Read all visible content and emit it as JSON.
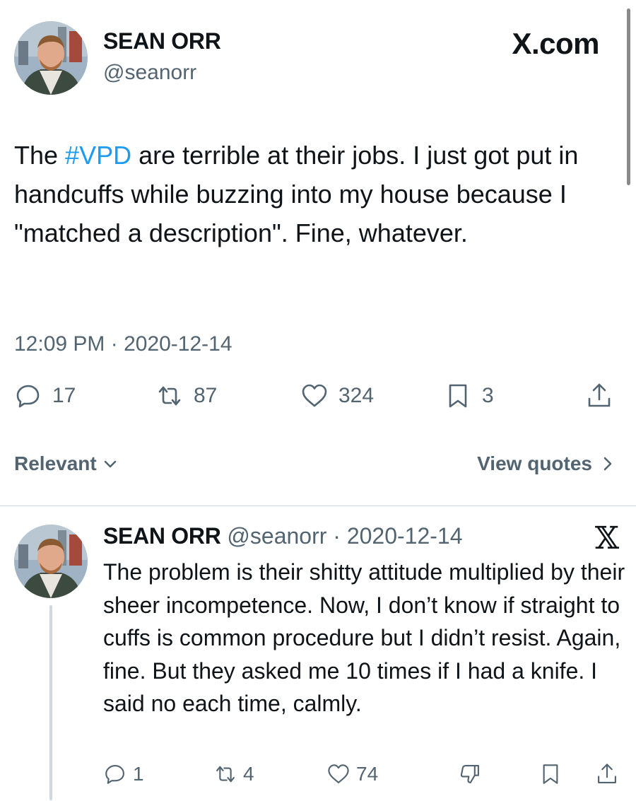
{
  "tweet": {
    "author_name": "SEAN ORR",
    "author_handle": "@seanorr",
    "brand": "X.com",
    "text_before_hashtag": "The ",
    "hashtag": "#VPD",
    "text_after_hashtag": " are terrible at their jobs. I just got put in handcuffs while buzzing into my house because I \"matched a description\". Fine, whatever.",
    "timestamp": "12:09 PM · 2020-12-14",
    "stats": {
      "replies": "17",
      "reposts": "87",
      "likes": "324",
      "bookmarks": "3"
    }
  },
  "sort": {
    "label": "Relevant",
    "view_quotes": "View quotes"
  },
  "reply": {
    "author_name": "SEAN ORR",
    "meta": " @seanorr · 2020-12-14",
    "text": "The problem is their shitty attitude multiplied by their sheer incompetence. Now, I don’t know if straight to cuffs is common procedure but I didn’t resist. Again, fine. But they asked me 10 times if I had a knife. I said no each time, calmly.",
    "stats": {
      "replies": "1",
      "reposts": "4",
      "likes": "74"
    }
  },
  "icons": {
    "reply": "reply-icon",
    "repost": "repost-icon",
    "like": "heart-icon",
    "bookmark": "bookmark-icon",
    "share": "share-icon",
    "dislike": "thumbs-down-icon",
    "x_logo": "x-logo-icon"
  },
  "colors": {
    "accent": "#1d9bf0",
    "text": "#0f1419",
    "secondary": "#536471",
    "divider": "#cfd9de"
  }
}
